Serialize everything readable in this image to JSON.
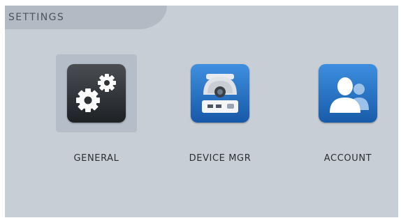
{
  "header": {
    "title": "SETTINGS"
  },
  "tiles": [
    {
      "label": "GENERAL",
      "icon": "gears-icon",
      "selected": true
    },
    {
      "label": "DEVICE MGR",
      "icon": "dome-camera-icon",
      "selected": false
    },
    {
      "label": "ACCOUNT",
      "icon": "users-icon",
      "selected": false
    }
  ],
  "colors": {
    "panel_bg": "#c8ced5",
    "title_tab_bg": "#b3bac3",
    "selected_tile_bg": "#b4bdc8",
    "general_icon_bg": "#2e3134",
    "blue_icon_bg": "#1f6fc1"
  }
}
